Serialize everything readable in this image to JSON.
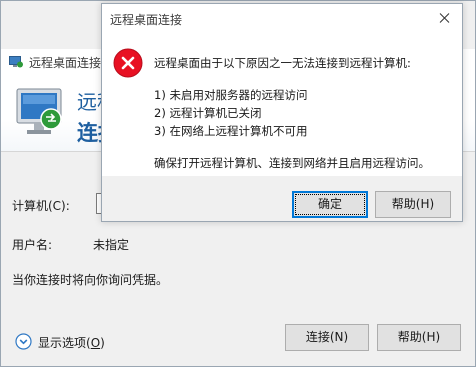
{
  "main": {
    "title": "远程桌面连接",
    "header_line1": "远程",
    "header_line2": "连接",
    "computer_label": "计算机(C):",
    "computer_value": "",
    "username_label": "用户名:",
    "username_value": "未指定",
    "note": "当你连接时将向你询问凭据。",
    "options_label": "显示选项(",
    "options_mnemonic": "O",
    "options_label_end": ")",
    "connect_button": "连接(N)",
    "help_button": "帮助(H)"
  },
  "dialog": {
    "title": "远程桌面连接",
    "message_main": "远程桌面由于以下原因之一无法连接到远程计算机:",
    "reasons": [
      "1) 未启用对服务器的远程访问",
      "2) 远程计算机已关闭",
      "3) 在网络上远程计算机不可用"
    ],
    "advice": "确保打开远程计算机、连接到网络并且启用远程访问。",
    "ok_button": "确定",
    "help_button": "帮助(H)"
  },
  "colors": {
    "accent": "#0078d7",
    "header_text": "#1e5fa0",
    "error_red": "#e81123"
  },
  "icons": {
    "app": "remote-desktop-icon",
    "error": "error-icon",
    "close": "close-icon",
    "options": "chevron-down-circle-icon"
  }
}
